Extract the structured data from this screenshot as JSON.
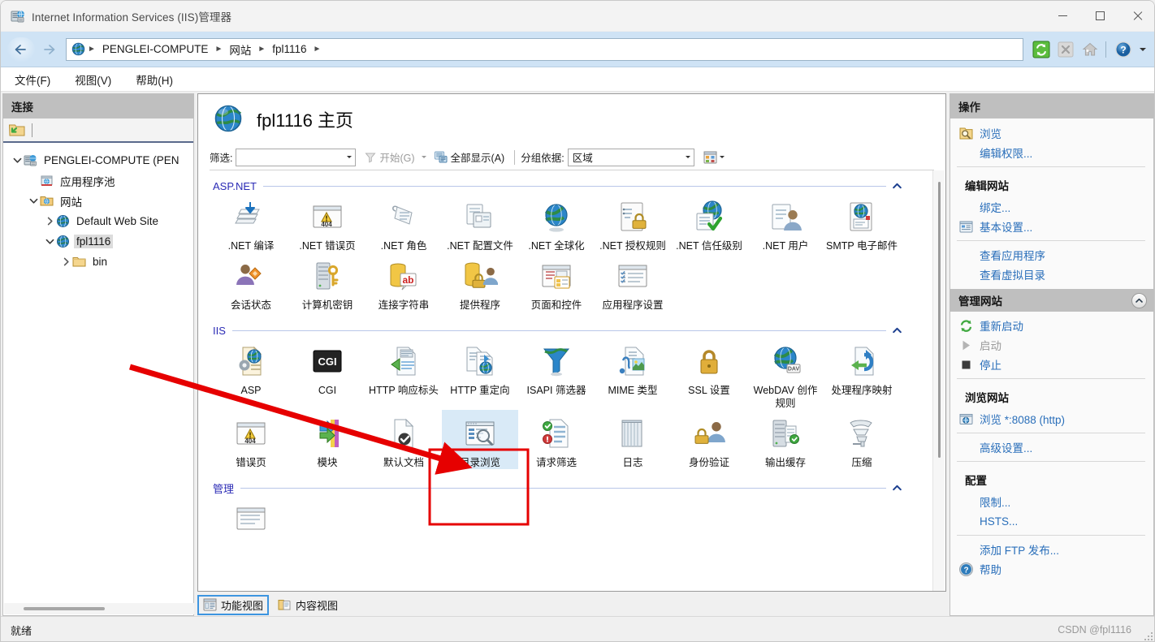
{
  "window": {
    "title": "Internet Information Services (IIS)管理器",
    "icon": "iis-manager-icon",
    "minimize_label": "最小化",
    "maximize_label": "最大化",
    "close_label": "关闭"
  },
  "addressbar": {
    "back_label": "←",
    "forward_label": "→",
    "breadcrumbs": [
      "PENGLEI-COMPUTE",
      "网站",
      "fpl1116"
    ],
    "separator": "►",
    "tools": [
      "refresh-icon",
      "stop-icon",
      "home-icon",
      "help-icon",
      "help-dropdown-icon"
    ]
  },
  "menubar": {
    "items": [
      "文件(F)",
      "视图(V)",
      "帮助(H)"
    ]
  },
  "connections": {
    "title": "连接",
    "toolbar": [
      "connect-to-icon"
    ],
    "tree": [
      {
        "label": "PENGLEI-COMPUTE (PEN",
        "icon": "server-icon",
        "depth": 0,
        "twisty": "expanded",
        "selected": false
      },
      {
        "label": "应用程序池",
        "icon": "app-pools-icon",
        "depth": 1,
        "twisty": "none",
        "selected": false
      },
      {
        "label": "网站",
        "icon": "sites-folder-icon",
        "depth": 1,
        "twisty": "expanded",
        "selected": false
      },
      {
        "label": "Default Web Site",
        "icon": "website-globe-icon",
        "depth": 2,
        "twisty": "collapsed",
        "selected": false
      },
      {
        "label": "fpl1116",
        "icon": "website-globe-icon",
        "depth": 2,
        "twisty": "expanded",
        "selected": true
      },
      {
        "label": "bin",
        "icon": "folder-icon",
        "depth": 3,
        "twisty": "collapsed",
        "selected": false
      }
    ]
  },
  "content": {
    "page_title": "fpl1116 主页",
    "title_icon": "website-globe-icon",
    "filter": {
      "label": "筛选:",
      "value": "",
      "placeholder": "",
      "go_label": "开始(G)",
      "show_all_label": "全部显示(A)",
      "group_by_label": "分组依据:",
      "group_by_value": "区域",
      "view_mode_icon": "view-mode-icon"
    },
    "sections": [
      {
        "name": "ASP.NET",
        "collapse_icon": "chevron-up-icon",
        "items": [
          {
            "label": ".NET 编译",
            "icon": "net-compilation-icon"
          },
          {
            "label": ".NET 错误页",
            "icon": "net-error-pages-icon"
          },
          {
            "label": ".NET 角色",
            "icon": "net-roles-icon"
          },
          {
            "label": ".NET 配置文件",
            "icon": "net-profile-icon"
          },
          {
            "label": ".NET 全球化",
            "icon": "net-globalization-icon"
          },
          {
            "label": ".NET 授权规则",
            "icon": "net-authorization-icon"
          },
          {
            "label": ".NET 信任级别",
            "icon": "net-trust-levels-icon"
          },
          {
            "label": ".NET 用户",
            "icon": "net-users-icon"
          },
          {
            "label": "SMTP 电子邮件",
            "icon": "smtp-email-icon"
          },
          {
            "label": "会话状态",
            "icon": "session-state-icon"
          },
          {
            "label": "计算机密钥",
            "icon": "machine-key-icon"
          },
          {
            "label": "连接字符串",
            "icon": "connection-strings-icon"
          },
          {
            "label": "提供程序",
            "icon": "providers-icon"
          },
          {
            "label": "页面和控件",
            "icon": "pages-and-controls-icon"
          },
          {
            "label": "应用程序设置",
            "icon": "application-settings-icon"
          }
        ]
      },
      {
        "name": "IIS",
        "collapse_icon": "chevron-up-icon",
        "items": [
          {
            "label": "ASP",
            "icon": "asp-icon"
          },
          {
            "label": "CGI",
            "icon": "cgi-icon"
          },
          {
            "label": "HTTP 响应标头",
            "icon": "http-response-headers-icon"
          },
          {
            "label": "HTTP 重定向",
            "icon": "http-redirect-icon"
          },
          {
            "label": "ISAPI 筛选器",
            "icon": "isapi-filters-icon"
          },
          {
            "label": "MIME 类型",
            "icon": "mime-types-icon"
          },
          {
            "label": "SSL 设置",
            "icon": "ssl-settings-icon"
          },
          {
            "label": "WebDAV 创作规则",
            "icon": "webdav-authoring-rules-icon"
          },
          {
            "label": "处理程序映射",
            "icon": "handler-mappings-icon"
          },
          {
            "label": "错误页",
            "icon": "error-pages-icon"
          },
          {
            "label": "模块",
            "icon": "modules-icon"
          },
          {
            "label": "默认文档",
            "icon": "default-document-icon"
          },
          {
            "label": "目录浏览",
            "icon": "directory-browsing-icon",
            "selected": true
          },
          {
            "label": "请求筛选",
            "icon": "request-filtering-icon"
          },
          {
            "label": "日志",
            "icon": "logging-icon"
          },
          {
            "label": "身份验证",
            "icon": "authentication-icon"
          },
          {
            "label": "输出缓存",
            "icon": "output-caching-icon"
          },
          {
            "label": "压缩",
            "icon": "compression-icon"
          }
        ]
      },
      {
        "name": "管理",
        "collapse_icon": "chevron-up-icon",
        "items": [
          {
            "label": "",
            "icon": "configuration-editor-icon"
          }
        ]
      }
    ],
    "view_tabs": [
      {
        "label": "功能视图",
        "icon": "features-view-icon",
        "active": true
      },
      {
        "label": "内容视图",
        "icon": "content-view-icon",
        "active": false
      }
    ]
  },
  "actions": {
    "title": "操作",
    "groups": [
      {
        "heading": "",
        "rows": [
          {
            "label": "浏览",
            "icon": "browse-icon",
            "disabled": false
          },
          {
            "label": "编辑权限...",
            "icon": "",
            "disabled": false
          }
        ]
      },
      {
        "heading": "编辑网站",
        "rows": [
          {
            "label": "绑定...",
            "icon": "",
            "disabled": false
          },
          {
            "label": "基本设置...",
            "icon": "basic-settings-icon",
            "disabled": false
          }
        ]
      },
      {
        "heading": "",
        "rows": [
          {
            "label": "查看应用程序",
            "icon": "",
            "disabled": false
          },
          {
            "label": "查看虚拟目录",
            "icon": "",
            "disabled": false
          }
        ]
      }
    ],
    "manage_site": {
      "title": "管理网站",
      "collapse_icon": "chevron-up-icon",
      "rows": [
        {
          "label": "重新启动",
          "icon": "restart-icon",
          "disabled": false
        },
        {
          "label": "启动",
          "icon": "start-icon",
          "disabled": true
        },
        {
          "label": "停止",
          "icon": "stop-square-icon",
          "disabled": false
        }
      ]
    },
    "browse_site": {
      "heading": "浏览网站",
      "rows": [
        {
          "label": "浏览 *:8088 (http)",
          "icon": "browse-binding-icon",
          "disabled": false
        }
      ]
    },
    "advanced": {
      "rows": [
        {
          "label": "高级设置...",
          "icon": "",
          "disabled": false
        }
      ]
    },
    "configure": {
      "heading": "配置",
      "rows": [
        {
          "label": "限制...",
          "icon": "",
          "disabled": false
        },
        {
          "label": "HSTS...",
          "icon": "",
          "disabled": false
        }
      ]
    },
    "footer": {
      "rows": [
        {
          "label": "添加 FTP 发布...",
          "icon": "",
          "disabled": false
        },
        {
          "label": "帮助",
          "icon": "help-circle-icon",
          "disabled": false
        }
      ]
    }
  },
  "statusbar": {
    "text": "就绪",
    "watermark": "CSDN @fpl1116"
  },
  "annotations": {
    "arrow_color": "#e60000",
    "highlight_color": "#e60000",
    "highlight_target": "目录浏览"
  },
  "colors": {
    "accent_blue": "#2a6fba",
    "section_blue": "#2b2bb5",
    "selection": "#d9eaf7",
    "addressbar": "#cfe3f5",
    "pane_header": "#bfbfbf"
  }
}
